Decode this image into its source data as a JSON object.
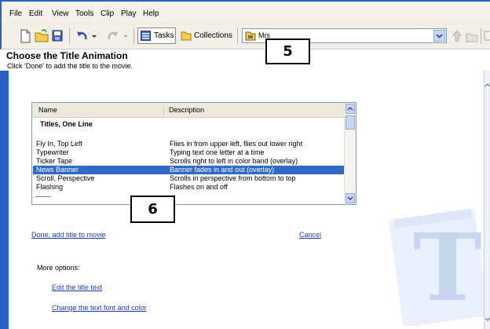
{
  "menu": [
    "File",
    "Edit",
    "View",
    "Tools",
    "Clip",
    "Play",
    "Help"
  ],
  "toolbar": {
    "tasks_label": "Tasks",
    "collections_label": "Collections",
    "collection_value": "Mrs"
  },
  "page": {
    "title": "Choose the Title Animation",
    "subtitle": "Click 'Done' to add the title to the movie."
  },
  "list": {
    "headers": [
      "Name",
      "Description"
    ],
    "group": "Titles, One Line",
    "rows": [
      {
        "name": "Fly In, Top Left",
        "desc": "Flies in from upper left, flies out lower right"
      },
      {
        "name": "Typewriter",
        "desc": "Typing text one letter at a time"
      },
      {
        "name": "Ticker Tape",
        "desc": "Scrolls right to left in color band (overlay)"
      },
      {
        "name": "News Banner",
        "desc": "Banner fades in and out (overlay)"
      },
      {
        "name": "Scroll, Perspective",
        "desc": "Scrolls in perspective from bottom to top"
      },
      {
        "name": "Flashing",
        "desc": "Flashes on and off"
      }
    ],
    "selected_index": 3
  },
  "callouts": {
    "a": "5",
    "b": "6"
  },
  "actions": {
    "done": "Done, add title to movie",
    "cancel": "Cancel",
    "more_options": "More options:",
    "edit_text": "Edit the title text",
    "change_font": "Change the text font and color"
  },
  "colors": {
    "selection": "#316ac5",
    "link": "#1a3fbf",
    "window_frame": "#2a5fc6"
  }
}
